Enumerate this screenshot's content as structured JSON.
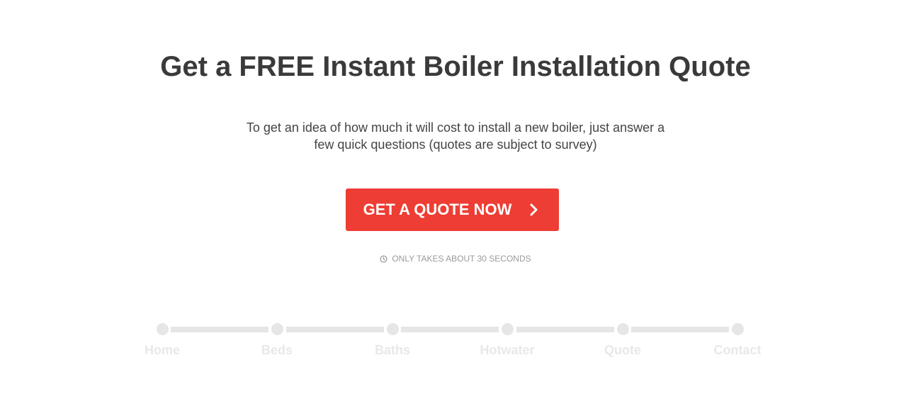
{
  "hero": {
    "title": "Get a FREE Instant Boiler Installation Quote",
    "subtitle": "To get an idea of how much it will cost to install a new boiler, just answer a few quick questions (quotes are subject to survey)",
    "cta_label": "GET A QUOTE NOW",
    "note": "ONLY TAKES ABOUT 30 SECONDS"
  },
  "steps": [
    {
      "label": "Home"
    },
    {
      "label": "Beds"
    },
    {
      "label": "Baths"
    },
    {
      "label": "Hotwater"
    },
    {
      "label": "Quote"
    },
    {
      "label": "Contact"
    }
  ],
  "colors": {
    "accent": "#ee3d34",
    "title": "#3a3a3a",
    "step_inactive": "#e6e6e6"
  },
  "icons": {
    "cta": "chevron-right-icon",
    "note": "clock-icon"
  }
}
